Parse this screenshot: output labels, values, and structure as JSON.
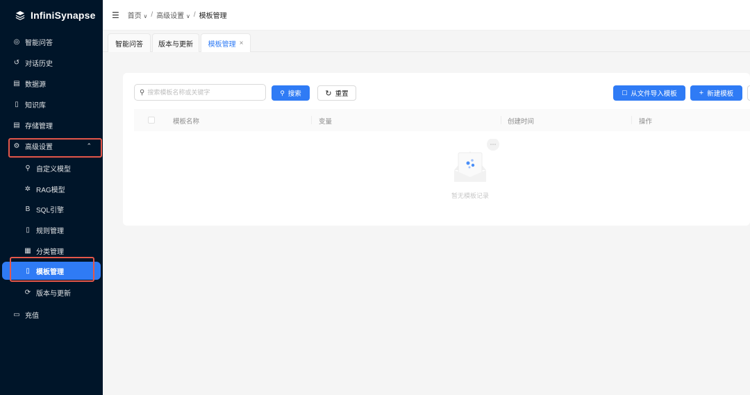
{
  "brand": {
    "prefix": "Infini",
    "suffix": "Synapse",
    "icon": "stack-layers-icon"
  },
  "sidebar": {
    "items": [
      {
        "label": "智能问答",
        "icon": "chat-icon"
      },
      {
        "label": "对话历史",
        "icon": "history-icon"
      },
      {
        "label": "数据源",
        "icon": "database-icon"
      },
      {
        "label": "知识库",
        "icon": "book-icon"
      },
      {
        "label": "存储管理",
        "icon": "storage-icon"
      },
      {
        "label": "高级设置",
        "icon": "gear-icon",
        "expanded": true
      },
      {
        "label": "充值",
        "icon": "card-icon"
      }
    ],
    "submenu": [
      {
        "label": "自定义模型",
        "icon": "search-icon"
      },
      {
        "label": "RAG模型",
        "icon": "bug-icon"
      },
      {
        "label": "SQL引擎",
        "icon": "b-letter-icon"
      },
      {
        "label": "规则管理",
        "icon": "file-icon"
      },
      {
        "label": "分类管理",
        "icon": "table-icon"
      },
      {
        "label": "模板管理",
        "icon": "file-text-icon",
        "active": true
      },
      {
        "label": "版本与更新",
        "icon": "sync-icon"
      }
    ]
  },
  "breadcrumb": {
    "home": "首页",
    "parent": "高级设置",
    "current": "模板管理",
    "separator": "/"
  },
  "tabs": [
    {
      "label": "智能问答"
    },
    {
      "label": "版本与更新"
    },
    {
      "label": "模板管理",
      "active": true
    }
  ],
  "toolbar": {
    "search_placeholder": "搜索模板名称或关键字",
    "search_button": "搜索",
    "reset_button": "重置",
    "import_button": "从文件导入模板",
    "new_button": "新建模板"
  },
  "table": {
    "columns": [
      "模板名称",
      "变量",
      "创建时间",
      "操作"
    ],
    "empty_text": "暂无模板记录"
  },
  "colors": {
    "primary": "#2f7bf5",
    "sidebar_bg": "#001529",
    "highlight_border": "#e5574a"
  }
}
